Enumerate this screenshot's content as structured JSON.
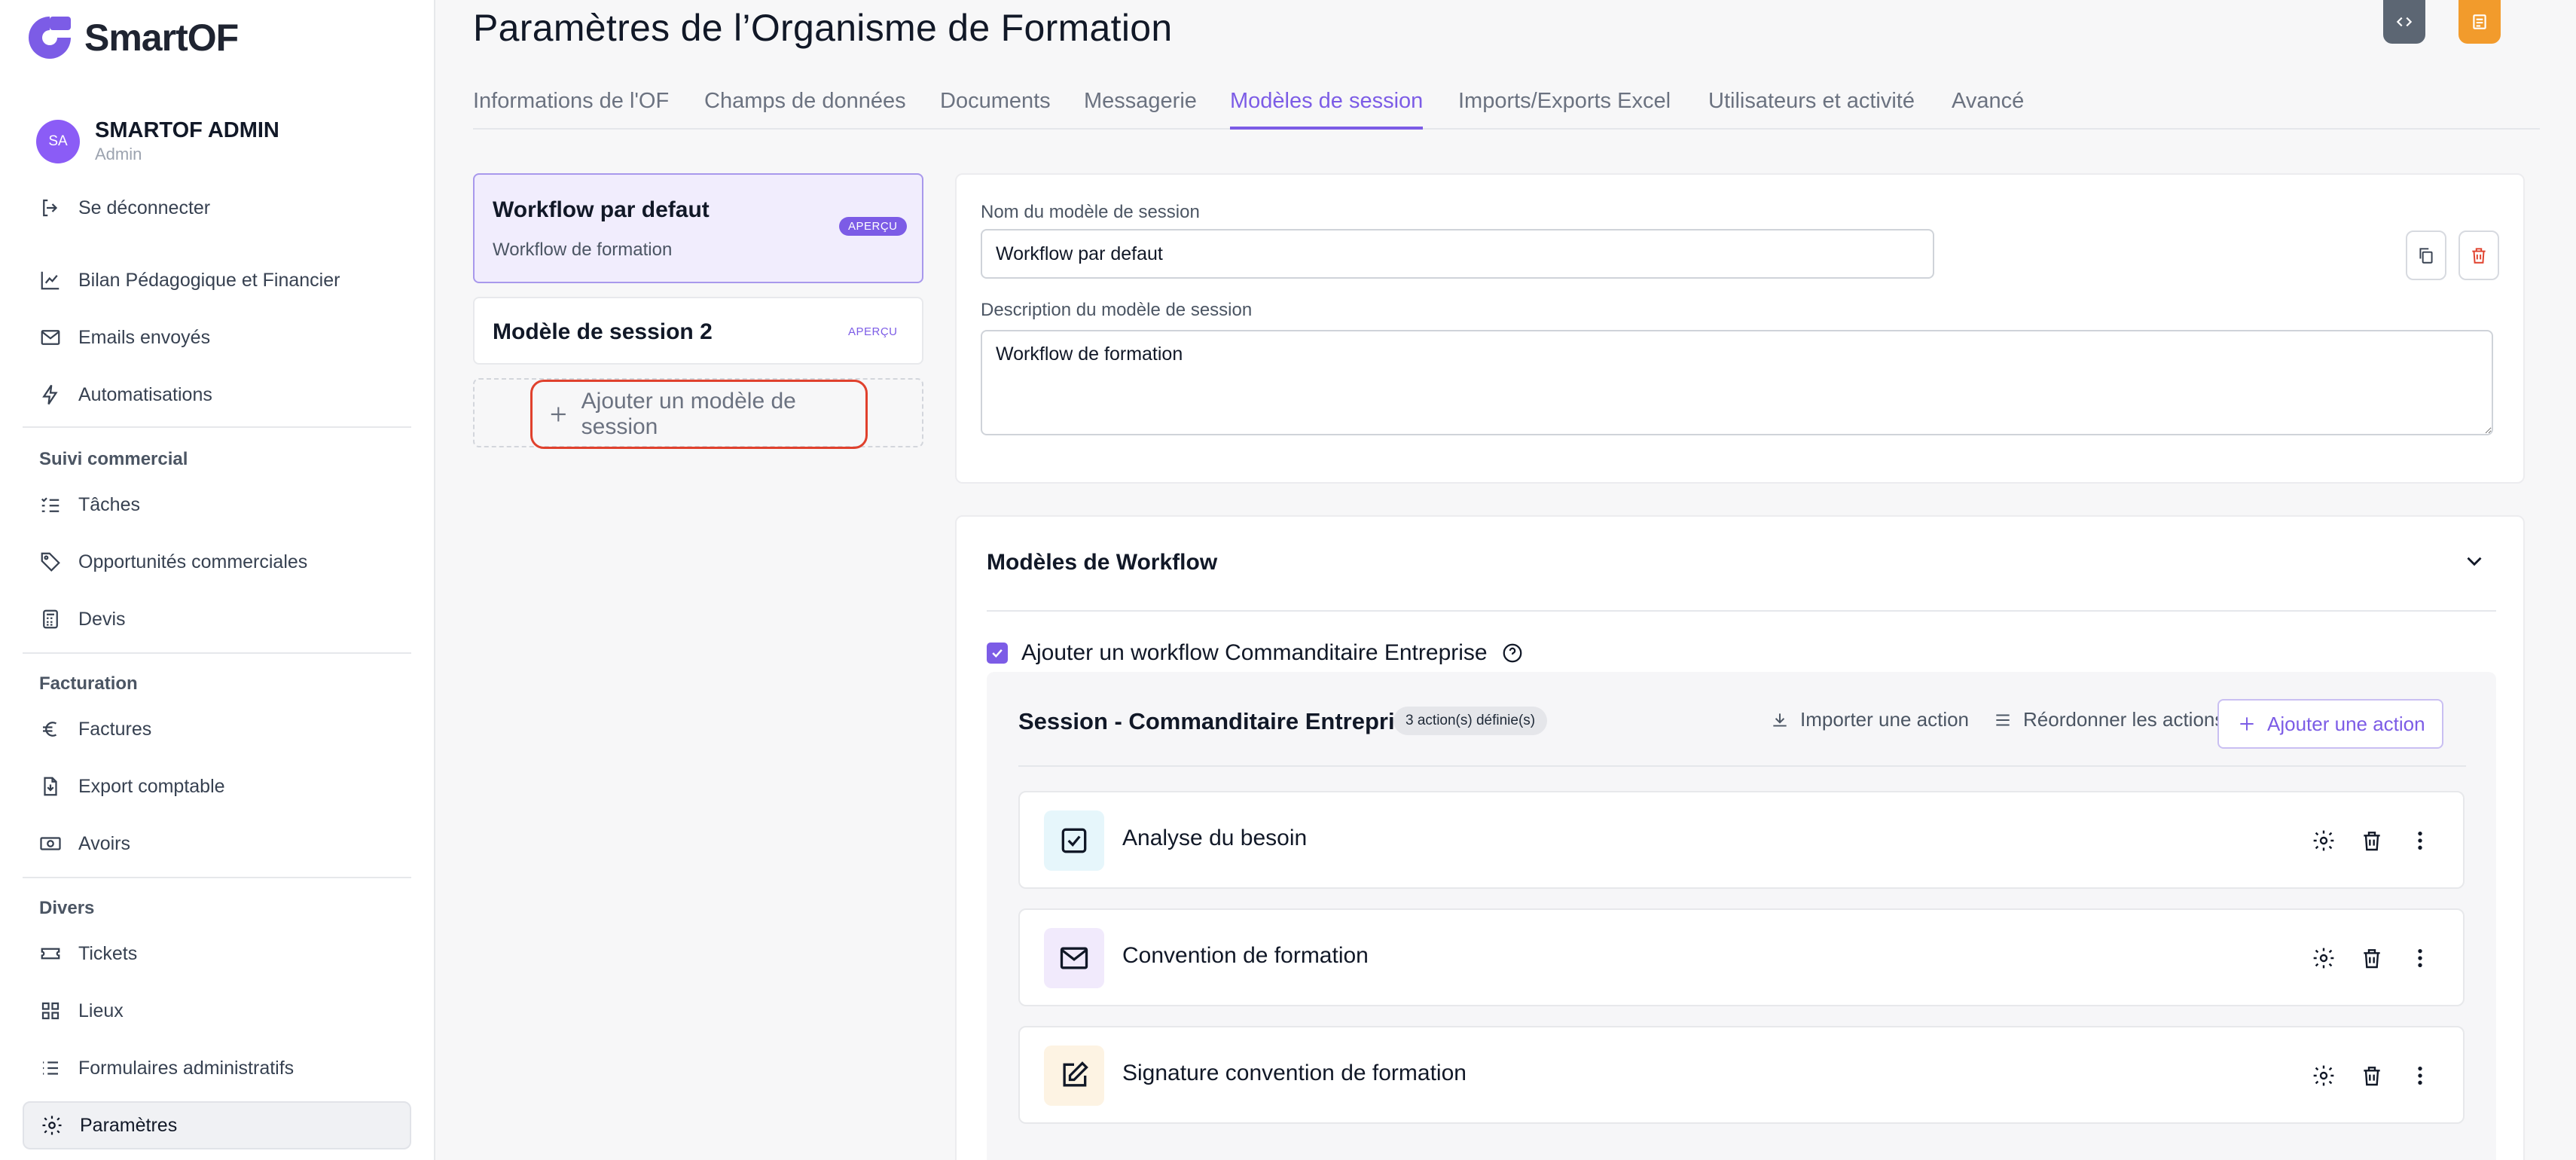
{
  "app": {
    "logo_text": "SmartOF"
  },
  "user": {
    "initials": "SA",
    "name": "SMARTOF ADMIN",
    "role": "Admin"
  },
  "sidebar": {
    "logout": "Se déconnecter",
    "items": [
      {
        "label": "Bilan Pédagogique et Financier",
        "icon": "chart-icon"
      },
      {
        "label": "Emails envoyés",
        "icon": "mail-icon"
      },
      {
        "label": "Automatisations",
        "icon": "bolt-icon"
      }
    ],
    "sections": [
      {
        "title": "Suivi commercial",
        "items": [
          {
            "label": "Tâches",
            "icon": "tasks-icon"
          },
          {
            "label": "Opportunités commerciales",
            "icon": "tag-icon"
          },
          {
            "label": "Devis",
            "icon": "calculator-icon"
          }
        ]
      },
      {
        "title": "Facturation",
        "items": [
          {
            "label": "Factures",
            "icon": "euro-icon"
          },
          {
            "label": "Export comptable",
            "icon": "file-export-icon"
          },
          {
            "label": "Avoirs",
            "icon": "banknote-icon"
          }
        ]
      },
      {
        "title": "Divers",
        "items": [
          {
            "label": "Tickets",
            "icon": "ticket-icon"
          },
          {
            "label": "Lieux",
            "icon": "grid-icon"
          },
          {
            "label": "Formulaires administratifs",
            "icon": "list-icon"
          },
          {
            "label": "Paramètres",
            "icon": "gear-icon",
            "active": true
          }
        ]
      }
    ]
  },
  "header": {
    "title": "Paramètres de l’Organisme de Formation"
  },
  "tabs": [
    {
      "label": "Informations de l'OF"
    },
    {
      "label": "Champs de données"
    },
    {
      "label": "Documents"
    },
    {
      "label": "Messagerie"
    },
    {
      "label": "Modèles de session",
      "active": true
    },
    {
      "label": "Imports/Exports Excel"
    },
    {
      "label": "Utilisateurs et activité"
    },
    {
      "label": "Avancé"
    }
  ],
  "templates": [
    {
      "title": "Workflow par defaut",
      "subtitle": "Workflow de formation",
      "badge": "APERÇU",
      "selected": true
    },
    {
      "title": "Modèle de session 2",
      "subtitle": "",
      "badge": "APERÇU",
      "selected": false
    }
  ],
  "add_template_label": "Ajouter un modèle de session",
  "form": {
    "name_label": "Nom du modèle de session",
    "name_value": "Workflow par defaut",
    "desc_label": "Description du modèle de session",
    "desc_value": "Workflow de formation"
  },
  "workflow": {
    "title": "Modèles de Workflow",
    "checkbox_label": "Ajouter un workflow Commanditaire Entreprise",
    "checkbox_checked": true,
    "session_title": "Session - Commanditaire Entreprise",
    "count_badge": "3 action(s) définie(s)",
    "import_label": "Importer une action",
    "reorder_label": "Réordonner les actions",
    "add_label": "Ajouter une action",
    "actions": [
      {
        "label": "Analyse du besoin",
        "icon": "checkbox-icon",
        "color": "#e6f6fb"
      },
      {
        "label": "Convention de formation",
        "icon": "mail-icon",
        "color": "#f1eafc"
      },
      {
        "label": "Signature convention de formation",
        "icon": "edit-icon",
        "color": "#fdf3e3"
      }
    ]
  },
  "colors": {
    "accent": "#7c5ce6",
    "highlight": "#e0412d",
    "topbar_code": "#5c6673",
    "topbar_doc": "#f29b2c"
  }
}
